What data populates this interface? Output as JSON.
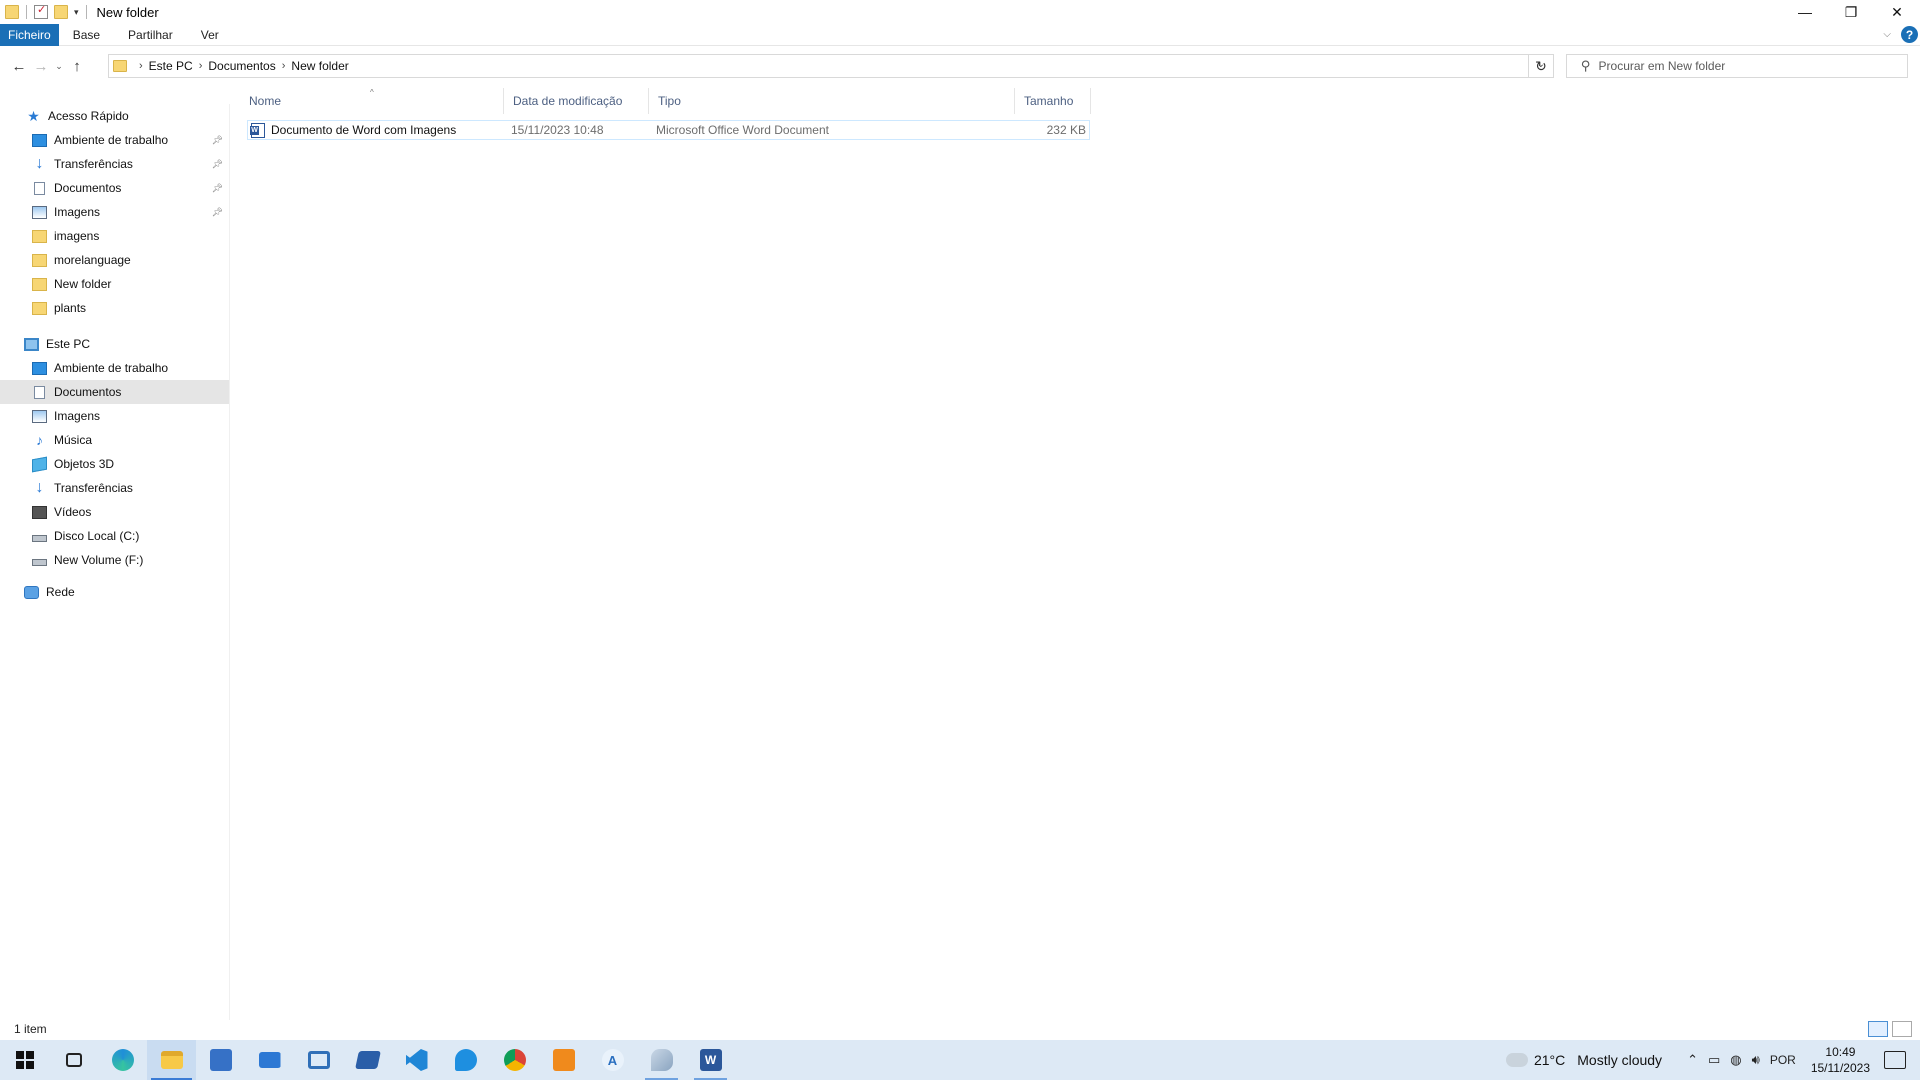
{
  "window": {
    "title": "New folder",
    "minimize": "—",
    "maximize": "❐",
    "close": "✕"
  },
  "ribbon": {
    "tabs": [
      "Ficheiro",
      "Base",
      "Partilhar",
      "Ver"
    ],
    "help": "?"
  },
  "address": {
    "crumbs": [
      "Este PC",
      "Documentos",
      "New folder"
    ],
    "search_placeholder": "Procurar em New folder"
  },
  "nav": {
    "quick_access": "Acesso Rápido",
    "quick_items": [
      {
        "label": "Ambiente de trabalho",
        "icon": "desktop-icon",
        "pinned": true
      },
      {
        "label": "Transferências",
        "icon": "downloads-icon",
        "pinned": true
      },
      {
        "label": "Documentos",
        "icon": "documents-icon",
        "pinned": true
      },
      {
        "label": "Imagens",
        "icon": "pictures-icon",
        "pinned": true
      },
      {
        "label": "imagens",
        "icon": "folder-icon",
        "pinned": false
      },
      {
        "label": "morelanguage",
        "icon": "folder-icon",
        "pinned": false
      },
      {
        "label": "New folder",
        "icon": "folder-icon",
        "pinned": false
      },
      {
        "label": "plants",
        "icon": "folder-icon",
        "pinned": false
      }
    ],
    "this_pc": "Este PC",
    "pc_items": [
      {
        "label": "Ambiente de trabalho",
        "icon": "desktop-icon"
      },
      {
        "label": "Documentos",
        "icon": "documents-icon",
        "selected": true
      },
      {
        "label": "Imagens",
        "icon": "pictures-icon"
      },
      {
        "label": "Música",
        "icon": "music-icon"
      },
      {
        "label": "Objetos 3D",
        "icon": "3d-objects-icon"
      },
      {
        "label": "Transferências",
        "icon": "downloads-icon"
      },
      {
        "label": "Vídeos",
        "icon": "videos-icon"
      },
      {
        "label": "Disco Local (C:)",
        "icon": "drive-icon"
      },
      {
        "label": "New Volume (F:)",
        "icon": "drive-icon"
      }
    ],
    "network": "Rede"
  },
  "files": {
    "columns": [
      "Nome",
      "Data de modificação",
      "Tipo",
      "Tamanho"
    ],
    "rows": [
      {
        "name": "Documento de Word com Imagens",
        "modified": "15/11/2023 10:48",
        "type": "Microsoft Office Word Document",
        "size": "232 KB",
        "icon": "word-document-icon"
      }
    ]
  },
  "status": {
    "count": "1 item"
  },
  "taskbar": {
    "apps": [
      "start",
      "task-view",
      "edge",
      "file-explorer",
      "store",
      "mail",
      "remote-desktop",
      "powershell",
      "vscode",
      "edge-dev",
      "chrome",
      "app-orange",
      "app-a",
      "paint",
      "word"
    ],
    "weather_temp": "21°C",
    "weather_text": "Mostly cloudy",
    "language": "POR",
    "time": "10:49",
    "date": "15/11/2023"
  },
  "colors": {
    "accent": "#1a6fb6",
    "selection_bg": "#e5e5e5",
    "taskbar_bg": "#dde9f5",
    "header_text": "#4d6082"
  }
}
